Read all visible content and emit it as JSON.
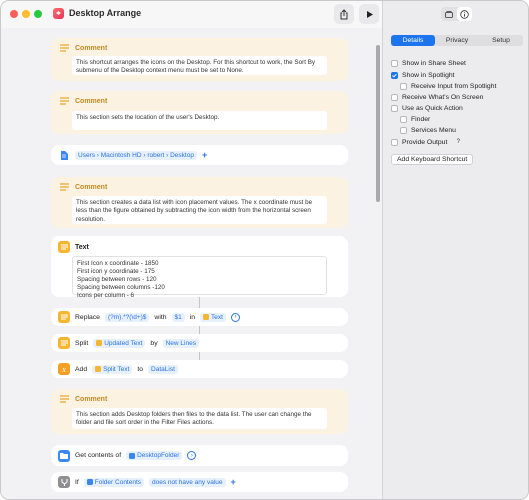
{
  "window": {
    "title": "Desktop Arrange"
  },
  "comments": [
    {
      "label": "Comment",
      "text": "This shortcut arranges the icons on the Desktop. For this shortcut to work, the Sort By submenu of the Desktop context menu must be set to None."
    },
    {
      "label": "Comment",
      "text": "This section sets the location of the user's Desktop."
    },
    {
      "label": "Comment",
      "text": "This section creates a data list with icon placement values. The x coordinate must be less than the figure obtained by subtracting the icon width from the horizontal screen resolution."
    },
    {
      "label": "Comment",
      "text": "This section adds Desktop folders then files to the data list. The user can change the folder and file sort order in the Filter Files actions."
    }
  ],
  "path_action": {
    "text": "Users › Macintosh HD › robert › Desktop"
  },
  "text_action": {
    "label": "Text",
    "content": "First Icon x coordinate - 1850\nFirst icon y coordinate - 175\nSpacing between rows - 120\nSpacing between columns -120\nIcons per column - 6"
  },
  "replace_action": {
    "verb": "Replace",
    "pattern": "(?m).*?(\\d+)$",
    "with_word": "with",
    "replacement": "$1",
    "in_word": "in",
    "target": "Text"
  },
  "split_action": {
    "verb": "Split",
    "target": "Updated Text",
    "by_word": "by",
    "separator": "New Lines"
  },
  "add_action": {
    "verb": "Add",
    "source": "Split Text",
    "to_word": "to",
    "destination": "DataList"
  },
  "getcontents_action": {
    "verb": "Get contents of",
    "folder": "DesktopFolder"
  },
  "if_action": {
    "verb": "If",
    "subject": "Folder Contents",
    "condition": "does not have any value"
  },
  "sidebar": {
    "tabs": [
      "Details",
      "Privacy",
      "Setup"
    ],
    "active_tab": "Details",
    "options": [
      {
        "label": "Show in Share Sheet",
        "checked": false
      },
      {
        "label": "Show in Spotlight",
        "checked": true
      },
      {
        "label": "Receive Input from Spotlight",
        "checked": false
      },
      {
        "label": "Receive What's On Screen",
        "checked": false
      },
      {
        "label": "Use as Quick Action",
        "checked": false
      },
      {
        "label": "Finder",
        "checked": false
      },
      {
        "label": "Services Menu",
        "checked": false
      },
      {
        "label": "Provide Output",
        "checked": false
      }
    ],
    "help_glyph": "?",
    "keyboard_button": "Add Keyboard Shortcut"
  },
  "colors": {
    "accent": "#1c74ee",
    "comment_bg": "#fbf2e2",
    "comment_label": "#c48a21"
  }
}
